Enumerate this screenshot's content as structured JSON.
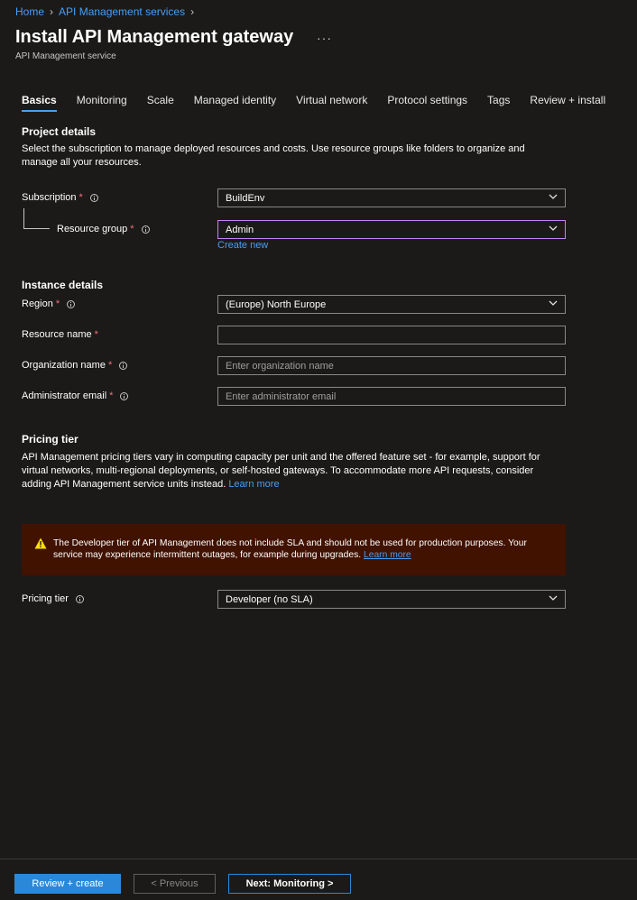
{
  "breadcrumb": {
    "items": [
      "Home",
      "API Management services"
    ]
  },
  "header": {
    "title": "Install API Management gateway",
    "more_label": "···",
    "subtitle": "API Management service"
  },
  "tabs": [
    {
      "label": "Basics",
      "active": true
    },
    {
      "label": "Monitoring"
    },
    {
      "label": "Scale"
    },
    {
      "label": "Managed identity"
    },
    {
      "label": "Virtual network"
    },
    {
      "label": "Protocol settings"
    },
    {
      "label": "Tags"
    },
    {
      "label": "Review + install"
    }
  ],
  "project": {
    "title": "Project details",
    "description": "Select the subscription to manage deployed resources and costs. Use resource groups like folders to organize and manage all your resources.",
    "subscription_label": "Subscription",
    "subscription_value": "BuildEnv",
    "resource_group_label": "Resource group",
    "resource_group_value": "Admin",
    "create_new": "Create new"
  },
  "instance": {
    "title": "Instance details",
    "region_label": "Region",
    "region_value": "(Europe) North Europe",
    "resource_name_label": "Resource name",
    "resource_name_value": "",
    "org_name_label": "Organization name",
    "org_name_placeholder": "Enter organization name",
    "admin_email_label": "Administrator email",
    "admin_email_placeholder": "Enter administrator email"
  },
  "pricing": {
    "title": "Pricing tier",
    "description": "API Management pricing tiers vary in computing capacity per unit and the offered feature set - for example, support for virtual networks, multi-regional deployments, or self-hosted gateways. To accommodate more API requests, consider adding API Management service units instead.",
    "learn_more": "Learn more",
    "warning_text": "The Developer tier of API Management does not include SLA and should not be used for production purposes. Your service may experience intermittent outages, for example during upgrades.",
    "warning_learn_more": "Learn more",
    "tier_label": "Pricing tier",
    "tier_value": "Developer (no SLA)"
  },
  "footer": {
    "review_create": "Review + create",
    "previous": "< Previous",
    "next": "Next: Monitoring >"
  },
  "colors": {
    "background": "#1b1a19",
    "accent": "#479ef5",
    "required": "#f1707b",
    "warning_bg": "#411200",
    "warning_icon": "#fce100"
  }
}
